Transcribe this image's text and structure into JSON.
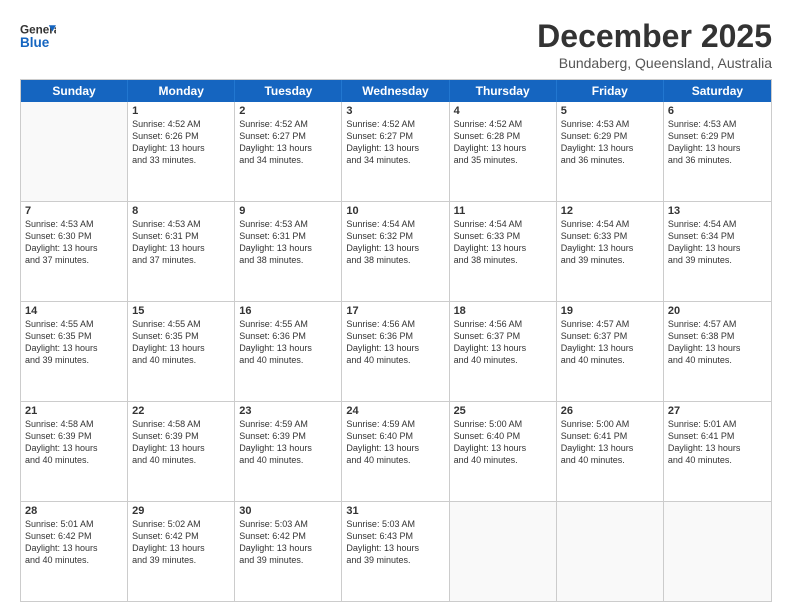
{
  "header": {
    "logo_general": "General",
    "logo_blue": "Blue",
    "title": "December 2025",
    "subtitle": "Bundaberg, Queensland, Australia"
  },
  "days_of_week": [
    "Sunday",
    "Monday",
    "Tuesday",
    "Wednesday",
    "Thursday",
    "Friday",
    "Saturday"
  ],
  "weeks": [
    [
      {
        "day": "",
        "sunrise": "",
        "sunset": "",
        "daylight": ""
      },
      {
        "day": "1",
        "sunrise": "Sunrise: 4:52 AM",
        "sunset": "Sunset: 6:26 PM",
        "daylight": "Daylight: 13 hours and 33 minutes."
      },
      {
        "day": "2",
        "sunrise": "Sunrise: 4:52 AM",
        "sunset": "Sunset: 6:27 PM",
        "daylight": "Daylight: 13 hours and 34 minutes."
      },
      {
        "day": "3",
        "sunrise": "Sunrise: 4:52 AM",
        "sunset": "Sunset: 6:27 PM",
        "daylight": "Daylight: 13 hours and 34 minutes."
      },
      {
        "day": "4",
        "sunrise": "Sunrise: 4:52 AM",
        "sunset": "Sunset: 6:28 PM",
        "daylight": "Daylight: 13 hours and 35 minutes."
      },
      {
        "day": "5",
        "sunrise": "Sunrise: 4:53 AM",
        "sunset": "Sunset: 6:29 PM",
        "daylight": "Daylight: 13 hours and 36 minutes."
      },
      {
        "day": "6",
        "sunrise": "Sunrise: 4:53 AM",
        "sunset": "Sunset: 6:29 PM",
        "daylight": "Daylight: 13 hours and 36 minutes."
      }
    ],
    [
      {
        "day": "7",
        "sunrise": "Sunrise: 4:53 AM",
        "sunset": "Sunset: 6:30 PM",
        "daylight": "Daylight: 13 hours and 37 minutes."
      },
      {
        "day": "8",
        "sunrise": "Sunrise: 4:53 AM",
        "sunset": "Sunset: 6:31 PM",
        "daylight": "Daylight: 13 hours and 37 minutes."
      },
      {
        "day": "9",
        "sunrise": "Sunrise: 4:53 AM",
        "sunset": "Sunset: 6:31 PM",
        "daylight": "Daylight: 13 hours and 38 minutes."
      },
      {
        "day": "10",
        "sunrise": "Sunrise: 4:54 AM",
        "sunset": "Sunset: 6:32 PM",
        "daylight": "Daylight: 13 hours and 38 minutes."
      },
      {
        "day": "11",
        "sunrise": "Sunrise: 4:54 AM",
        "sunset": "Sunset: 6:33 PM",
        "daylight": "Daylight: 13 hours and 38 minutes."
      },
      {
        "day": "12",
        "sunrise": "Sunrise: 4:54 AM",
        "sunset": "Sunset: 6:33 PM",
        "daylight": "Daylight: 13 hours and 39 minutes."
      },
      {
        "day": "13",
        "sunrise": "Sunrise: 4:54 AM",
        "sunset": "Sunset: 6:34 PM",
        "daylight": "Daylight: 13 hours and 39 minutes."
      }
    ],
    [
      {
        "day": "14",
        "sunrise": "Sunrise: 4:55 AM",
        "sunset": "Sunset: 6:35 PM",
        "daylight": "Daylight: 13 hours and 39 minutes."
      },
      {
        "day": "15",
        "sunrise": "Sunrise: 4:55 AM",
        "sunset": "Sunset: 6:35 PM",
        "daylight": "Daylight: 13 hours and 40 minutes."
      },
      {
        "day": "16",
        "sunrise": "Sunrise: 4:55 AM",
        "sunset": "Sunset: 6:36 PM",
        "daylight": "Daylight: 13 hours and 40 minutes."
      },
      {
        "day": "17",
        "sunrise": "Sunrise: 4:56 AM",
        "sunset": "Sunset: 6:36 PM",
        "daylight": "Daylight: 13 hours and 40 minutes."
      },
      {
        "day": "18",
        "sunrise": "Sunrise: 4:56 AM",
        "sunset": "Sunset: 6:37 PM",
        "daylight": "Daylight: 13 hours and 40 minutes."
      },
      {
        "day": "19",
        "sunrise": "Sunrise: 4:57 AM",
        "sunset": "Sunset: 6:37 PM",
        "daylight": "Daylight: 13 hours and 40 minutes."
      },
      {
        "day": "20",
        "sunrise": "Sunrise: 4:57 AM",
        "sunset": "Sunset: 6:38 PM",
        "daylight": "Daylight: 13 hours and 40 minutes."
      }
    ],
    [
      {
        "day": "21",
        "sunrise": "Sunrise: 4:58 AM",
        "sunset": "Sunset: 6:39 PM",
        "daylight": "Daylight: 13 hours and 40 minutes."
      },
      {
        "day": "22",
        "sunrise": "Sunrise: 4:58 AM",
        "sunset": "Sunset: 6:39 PM",
        "daylight": "Daylight: 13 hours and 40 minutes."
      },
      {
        "day": "23",
        "sunrise": "Sunrise: 4:59 AM",
        "sunset": "Sunset: 6:39 PM",
        "daylight": "Daylight: 13 hours and 40 minutes."
      },
      {
        "day": "24",
        "sunrise": "Sunrise: 4:59 AM",
        "sunset": "Sunset: 6:40 PM",
        "daylight": "Daylight: 13 hours and 40 minutes."
      },
      {
        "day": "25",
        "sunrise": "Sunrise: 5:00 AM",
        "sunset": "Sunset: 6:40 PM",
        "daylight": "Daylight: 13 hours and 40 minutes."
      },
      {
        "day": "26",
        "sunrise": "Sunrise: 5:00 AM",
        "sunset": "Sunset: 6:41 PM",
        "daylight": "Daylight: 13 hours and 40 minutes."
      },
      {
        "day": "27",
        "sunrise": "Sunrise: 5:01 AM",
        "sunset": "Sunset: 6:41 PM",
        "daylight": "Daylight: 13 hours and 40 minutes."
      }
    ],
    [
      {
        "day": "28",
        "sunrise": "Sunrise: 5:01 AM",
        "sunset": "Sunset: 6:42 PM",
        "daylight": "Daylight: 13 hours and 40 minutes."
      },
      {
        "day": "29",
        "sunrise": "Sunrise: 5:02 AM",
        "sunset": "Sunset: 6:42 PM",
        "daylight": "Daylight: 13 hours and 39 minutes."
      },
      {
        "day": "30",
        "sunrise": "Sunrise: 5:03 AM",
        "sunset": "Sunset: 6:42 PM",
        "daylight": "Daylight: 13 hours and 39 minutes."
      },
      {
        "day": "31",
        "sunrise": "Sunrise: 5:03 AM",
        "sunset": "Sunset: 6:43 PM",
        "daylight": "Daylight: 13 hours and 39 minutes."
      },
      {
        "day": "",
        "sunrise": "",
        "sunset": "",
        "daylight": ""
      },
      {
        "day": "",
        "sunrise": "",
        "sunset": "",
        "daylight": ""
      },
      {
        "day": "",
        "sunrise": "",
        "sunset": "",
        "daylight": ""
      }
    ]
  ]
}
